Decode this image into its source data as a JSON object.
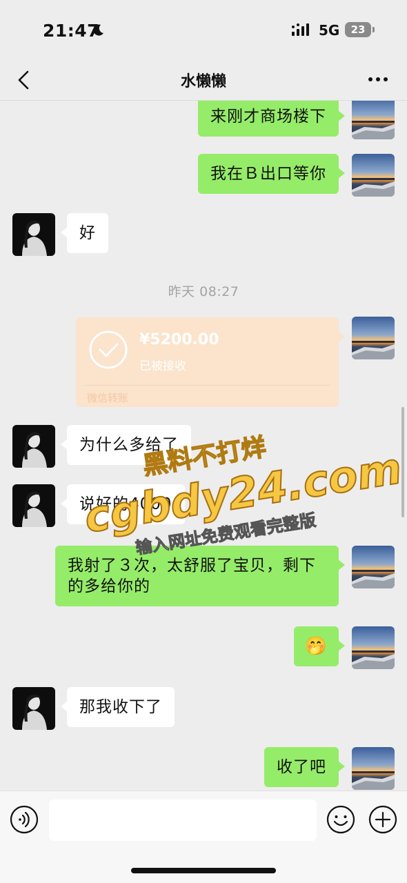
{
  "status_bar": {
    "time": "21:47",
    "network": "5G",
    "battery": "23"
  },
  "header": {
    "title": "水懒懒"
  },
  "messages": [
    {
      "side": "me",
      "type": "text",
      "text": "来刚才商场楼下"
    },
    {
      "side": "me",
      "type": "text",
      "text": "我在Ｂ出口等你"
    },
    {
      "side": "other",
      "type": "text",
      "text": "好"
    },
    {
      "type": "timestamp",
      "text": "昨天 08:27"
    },
    {
      "side": "me",
      "type": "transfer",
      "amount": "¥5200.00",
      "status": "已被接收",
      "label": "微信转账"
    },
    {
      "side": "other",
      "type": "text",
      "text": "为什么多给了"
    },
    {
      "side": "other",
      "type": "text",
      "text": "说好的4000"
    },
    {
      "side": "me",
      "type": "text",
      "text": "我射了３次，太舒服了宝贝，剩下的多给你的"
    },
    {
      "side": "me",
      "type": "emoji",
      "text": "🤭"
    },
    {
      "side": "other",
      "type": "text",
      "text": "那我收下了"
    },
    {
      "side": "me",
      "type": "text",
      "text": "收了吧"
    }
  ],
  "watermark": {
    "line1": "黑料不打烊",
    "line2": "cgbdy24.com",
    "line3": "输入网址免费观看完整版"
  },
  "input_bar": {
    "placeholder": ""
  },
  "icons": {
    "back": "chevron-left-icon",
    "more": "more-dots-icon",
    "voice": "voice-icon",
    "emoji": "emoji-icon",
    "plus": "plus-icon",
    "transfer": "check-circle-icon"
  },
  "colors": {
    "my_bubble": "#95ec69",
    "other_bubble": "#ffffff",
    "transfer": "#fbe3cc",
    "background": "#ededed"
  }
}
